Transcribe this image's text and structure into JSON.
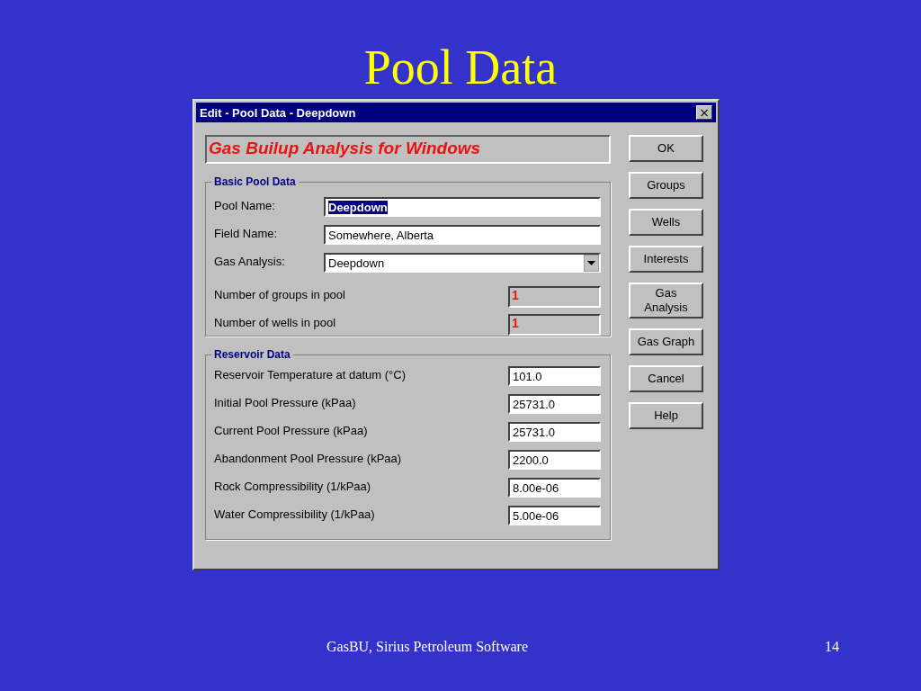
{
  "slide": {
    "title": "Pool Data",
    "footer": "GasBU, Sirius Petroleum Software",
    "page_number": "14"
  },
  "window": {
    "title": "Edit - Pool Data - Deepdown",
    "close": "×"
  },
  "banner": "Gas Builup Analysis for Windows",
  "basic": {
    "title": "Basic Pool Data",
    "fields": [
      {
        "kind": "text",
        "label": "Pool Name:",
        "value": "Deepdown",
        "highlighted": true
      },
      {
        "kind": "text",
        "label": "Field Name:",
        "value": "Somewhere, Alberta",
        "highlighted": false
      },
      {
        "kind": "dropdown",
        "label": "Gas Analysis:",
        "value": "Deepdown",
        "highlighted": false
      }
    ],
    "counts": [
      {
        "label": "Number of groups in pool",
        "value": "1"
      },
      {
        "label": "Number of wells in pool",
        "value": "1"
      }
    ]
  },
  "reservoir": {
    "title": "Reservoir Data",
    "fields": [
      {
        "label": "Reservoir Temperature at datum (°C)",
        "value": "101.0"
      },
      {
        "label": "Initial Pool Pressure (kPaa)",
        "value": "25731.0"
      },
      {
        "label": "Current Pool Pressure (kPaa)",
        "value": "25731.0"
      },
      {
        "label": "Abandonment Pool Pressure (kPaa)",
        "value": "2200.0"
      },
      {
        "label": "Rock Compressibility (1/kPaa)",
        "value": "8.00e-06"
      },
      {
        "label": "Water Compressibility (1/kPaa)",
        "value": "5.00e-06"
      }
    ]
  },
  "buttons": [
    "OK",
    "Groups",
    "Wells",
    "Interests",
    "Gas\nAnalysis",
    "Gas Graph",
    "Cancel",
    "Help"
  ]
}
